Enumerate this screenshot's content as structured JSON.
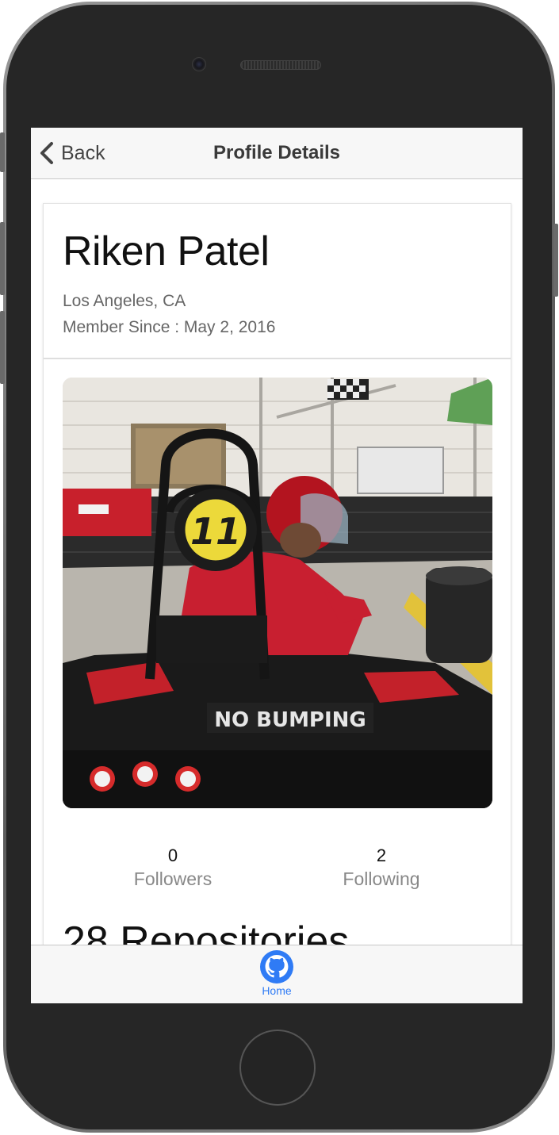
{
  "navbar": {
    "back_label": "Back",
    "title": "Profile Details"
  },
  "profile": {
    "name": "Riken Patel",
    "location": "Los Angeles, CA",
    "member_since": "Member Since : May 2, 2016",
    "photo_text": {
      "kart_number": "11",
      "bumper_text": "NO BUMPING"
    }
  },
  "stats": {
    "followers": {
      "count": "0",
      "label": "Followers"
    },
    "following": {
      "count": "2",
      "label": "Following"
    }
  },
  "repositories": {
    "heading": "28 Repositories"
  },
  "tabbar": {
    "items": [
      {
        "label": "Home",
        "icon": "github-icon",
        "active": true
      }
    ]
  },
  "colors": {
    "accent": "#2f7bf5",
    "nav_background": "#f7f7f7",
    "device_body": "#262626"
  }
}
